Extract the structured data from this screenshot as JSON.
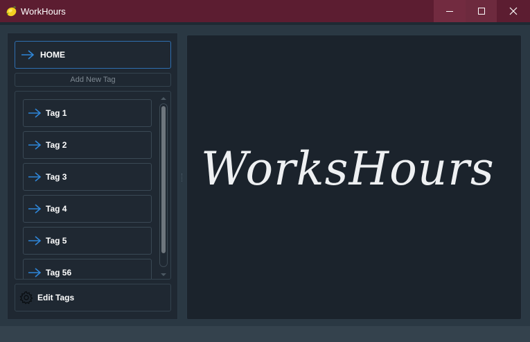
{
  "window": {
    "title": "WorkHours",
    "controls": {
      "minimize": "minimize-icon",
      "maximize": "maximize-icon",
      "close": "close-icon"
    }
  },
  "sidebar": {
    "home_label": "HOME",
    "add_tag_label": "Add New Tag",
    "tags": [
      {
        "label": "Tag 1"
      },
      {
        "label": "Tag 2"
      },
      {
        "label": "Tag 3"
      },
      {
        "label": "Tag 4"
      },
      {
        "label": "Tag 5"
      },
      {
        "label": "Tag 56"
      }
    ],
    "edit_tags_label": "Edit Tags"
  },
  "main": {
    "logo_text": "WorksHours"
  },
  "colors": {
    "titlebar": "#5c1d31",
    "accent_arrow": "#2f86d8",
    "panel": "#1f2832",
    "main_panel": "#1b232c"
  }
}
